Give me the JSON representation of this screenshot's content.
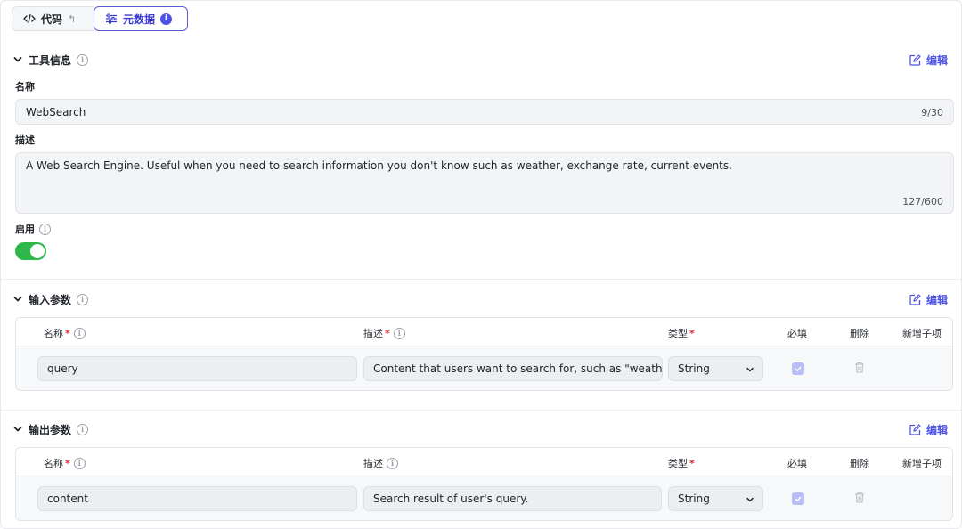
{
  "tabs": {
    "code_label": "代码",
    "meta_label": "元数据",
    "meta_badge": "i"
  },
  "tool_info": {
    "title": "工具信息",
    "edit_label": "编辑",
    "name_label": "名称",
    "name_value": "WebSearch",
    "name_count": "9/30",
    "desc_label": "描述",
    "desc_value": "A Web Search Engine. Useful when you need to search information you don't know such as weather, exchange rate, current events.",
    "desc_count": "127/600",
    "enable_label": "启用",
    "enabled": true
  },
  "input_params": {
    "title": "输入参数",
    "edit_label": "编辑",
    "columns": {
      "name": "名称",
      "desc": "描述",
      "type": "类型",
      "required": "必填",
      "delete": "删除",
      "add_child": "新增子项"
    },
    "rows": [
      {
        "name": "query",
        "desc": "Content that users want to search for, such as \"weather",
        "type": "String",
        "required": true
      }
    ]
  },
  "output_params": {
    "title": "输出参数",
    "edit_label": "编辑",
    "columns": {
      "name": "名称",
      "desc": "描述",
      "type": "类型",
      "required": "必填",
      "delete": "删除",
      "add_child": "新增子项"
    },
    "rows": [
      {
        "name": "content",
        "desc": "Search result of user's query.",
        "type": "String",
        "required": true
      }
    ]
  },
  "colors": {
    "accent": "#4d53e8",
    "toggle_on": "#2fb84a",
    "required_mark": "#e0252f"
  }
}
